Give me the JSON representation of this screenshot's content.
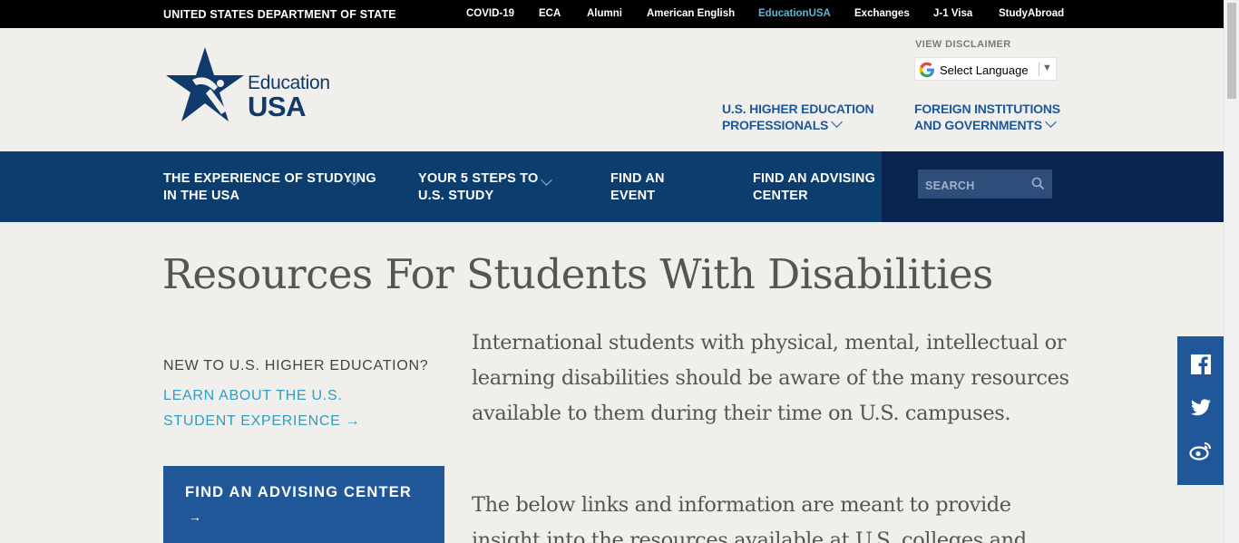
{
  "topbar": {
    "department": "UNITED STATES DEPARTMENT OF STATE",
    "links": [
      {
        "label": "COVID-19",
        "active": false
      },
      {
        "label": "ECA",
        "active": false
      },
      {
        "label": "Alumni",
        "active": false
      },
      {
        "label": "American English",
        "active": false
      },
      {
        "label": "EducationUSA",
        "active": true
      },
      {
        "label": "Exchanges",
        "active": false
      },
      {
        "label": "J-1 Visa",
        "active": false
      },
      {
        "label": "StudyAbroad",
        "active": false
      }
    ]
  },
  "logo": {
    "line1": "Education",
    "line2": "USA"
  },
  "header": {
    "disclaimer": "VIEW DISCLAIMER",
    "language_label": "Select Language",
    "nav": [
      {
        "label_line1": "U.S. HIGHER EDUCATION",
        "label_line2": "PROFESSIONALS"
      },
      {
        "label_line1": "FOREIGN INSTITUTIONS",
        "label_line2": "AND GOVERNMENTS"
      }
    ]
  },
  "mainnav": {
    "items": [
      {
        "line1": "THE EXPERIENCE OF STUDYING",
        "line2": "IN THE USA",
        "dropdown": true
      },
      {
        "line1": "YOUR 5 STEPS TO",
        "line2": "U.S. STUDY",
        "dropdown": true
      },
      {
        "line1": "FIND AN",
        "line2": "EVENT",
        "dropdown": false
      },
      {
        "line1": "FIND AN ADVISING",
        "line2": "CENTER",
        "dropdown": false
      }
    ],
    "search_placeholder": "SEARCH"
  },
  "page": {
    "title": "Resources For Students With Disabilities",
    "sidebar": {
      "new_to": "NEW TO U.S. HIGHER EDUCATION?",
      "learn_link": "LEARN ABOUT THE U.S. STUDENT EXPERIENCE",
      "advising_button": "FIND AN ADVISING CENTER",
      "arrow": "→"
    },
    "paragraphs": [
      "International students with physical, mental, intellectual or learning disabilities should be aware of the many resources available to them during their time on U.S. campuses.",
      "The below links and information are meant to provide insight into the resources available at U.S. colleges and"
    ]
  },
  "social": [
    "facebook-icon",
    "twitter-icon",
    "weibo-icon"
  ],
  "colors": {
    "navy": "#0b3d6f",
    "accent": "#1f5799",
    "link": "#2d9ec4",
    "active_top": "#5bb7d6"
  }
}
